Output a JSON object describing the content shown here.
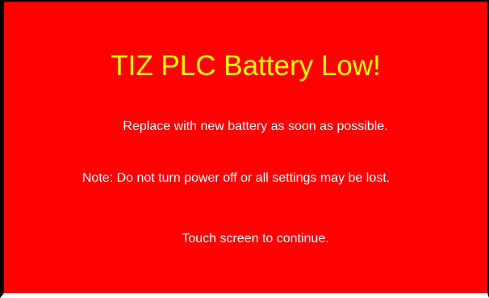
{
  "alert": {
    "title": "TIZ PLC Battery Low!",
    "message_replace": "Replace with new battery as soon as possible.",
    "message_note": "Note: Do not turn power off or all settings may be lost.",
    "message_touch": "Touch screen to continue."
  },
  "colors": {
    "background": "#ff0000",
    "title": "#ffff00",
    "text": "#ffffff"
  }
}
